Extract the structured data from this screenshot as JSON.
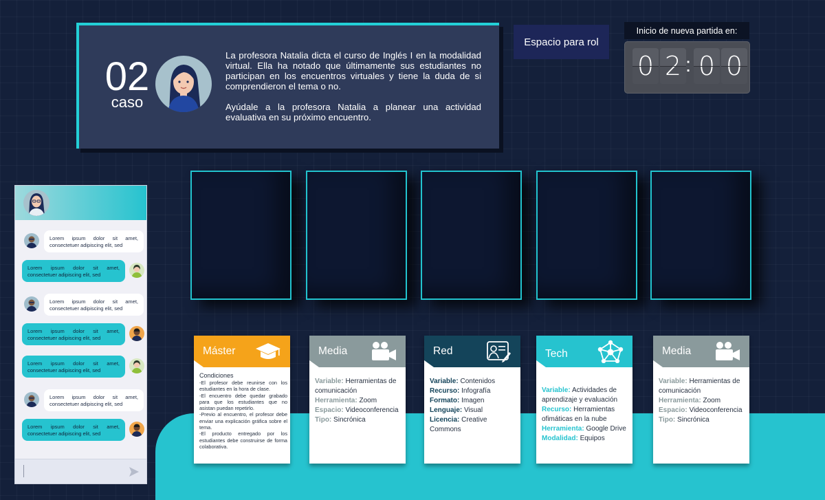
{
  "case": {
    "number": "02",
    "label": "caso",
    "paragraph1": "La profesora Natalia dicta el curso de Inglés I en la modalidad virtual. Ella ha notado que últimamente sus estudiantes no participan en los encuentros virtuales y tiene la duda de si comprendieron el tema o no.",
    "paragraph2": "Ayúdale a la profesora Natalia a planear una actividad evaluativa en su próximo encuentro."
  },
  "role_button": "Espacio para rol",
  "timer": {
    "label": "Inicio de nueva partida en:",
    "digits": [
      "0",
      "2",
      "0",
      "0"
    ],
    "separator": ":"
  },
  "chat": {
    "messages": [
      {
        "direction": "in",
        "text": "Lorem ipsum dolor sit amet, consectetuer adipiscing elit, sed"
      },
      {
        "direction": "out",
        "text": "Lorem ipsum dolor sit amet, consectetuer adipiscing elit, sed"
      },
      {
        "direction": "in",
        "text": "Lorem ipsum dolor sit amet, consectetuer adipiscing elit, sed"
      },
      {
        "direction": "out",
        "text": "Lorem ipsum dolor sit amet, consectetuer adipiscing elit, sed"
      },
      {
        "direction": "out",
        "text": "Lorem ipsum dolor sit amet, consectetuer adipiscing elit, sed"
      },
      {
        "direction": "in",
        "text": "Lorem ipsum dolor sit amet, consectetuer adipiscing elit, sed"
      },
      {
        "direction": "out",
        "text": "Lorem ipsum dolor sit amet, consectetuer adipiscing elit, sed"
      }
    ],
    "input_value": "",
    "send_icon": "send-icon"
  },
  "slots_count": 5,
  "cards": {
    "master": {
      "title": "Máster",
      "icon": "graduation-cap-icon",
      "color": "#f5a31a",
      "conditions_title": "Condiciones",
      "conditions": [
        "-El profesor debe reunirse con los estudiantes en la hora de clase.",
        "-El encuentro debe quedar grabado para que los estudiantes que no asistan puedan repetirlo.",
        "-Previo al encuentro, el profesor debe enviar una explicación gráfica sobre el tema.",
        "-El producto entregado por los estudiantes debe construirse de forma colaborativa."
      ]
    },
    "media1": {
      "title": "Media",
      "icon": "video-camera-icon",
      "color": "#8a9a9c",
      "fields": [
        {
          "k": "Variable:",
          "v": "Herramientas de comunicación"
        },
        {
          "k": "Herramienta:",
          "v": "Zoom"
        },
        {
          "k": "Espacio:",
          "v": "Videoconferencia"
        },
        {
          "k": "Tipo:",
          "v": "Sincrónica"
        }
      ]
    },
    "red": {
      "title": "Red",
      "icon": "document-user-icon",
      "color": "#14445a",
      "fields": [
        {
          "k": "Variable:",
          "v": "Contenidos"
        },
        {
          "k": "Recurso:",
          "v": "Infografía"
        },
        {
          "k": "Formato:",
          "v": "Imagen"
        },
        {
          "k": "Lenguaje:",
          "v": "Visual"
        },
        {
          "k": "Licencia:",
          "v": "Creative Commons"
        }
      ]
    },
    "tech": {
      "title": "Tech",
      "icon": "network-icon",
      "color": "#26c3cf",
      "fields": [
        {
          "k": "Variable:",
          "v": "Actividades de aprendizaje y evaluación"
        },
        {
          "k": "Recurso:",
          "v": "Herramientas ofimáticas en la nube"
        },
        {
          "k": "Herramienta:",
          "v": "Google Drive"
        },
        {
          "k": "Modalidad:",
          "v": "Equipos"
        }
      ]
    },
    "media2": {
      "title": "Media",
      "icon": "video-camera-icon",
      "color": "#8a9a9c",
      "fields": [
        {
          "k": "Variable:",
          "v": "Herramientas de comunicación"
        },
        {
          "k": "Herramienta:",
          "v": "Zoom"
        },
        {
          "k": "Espacio:",
          "v": "Videoconferencia"
        },
        {
          "k": "Tipo:",
          "v": "Sincrónica"
        }
      ]
    }
  }
}
